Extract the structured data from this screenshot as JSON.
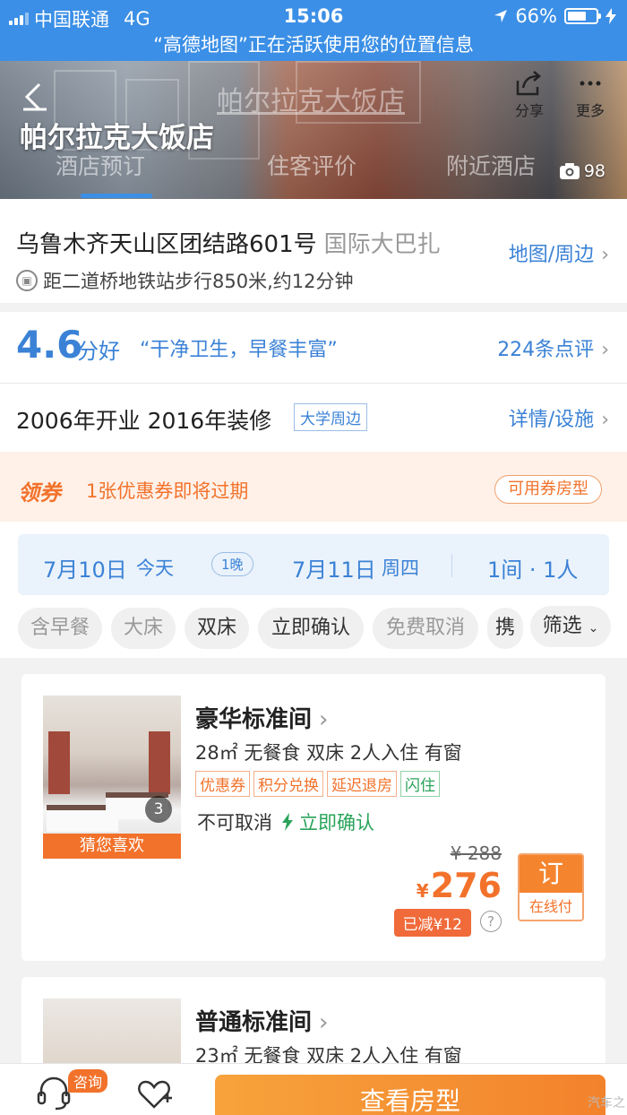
{
  "status": {
    "carrier": "中国联通",
    "network": "4G",
    "time": "15:06",
    "battery": "66%",
    "battery_level": 0.66
  },
  "location_banner": "“高德地图”正在活跃使用您的位置信息",
  "hero": {
    "hotel_name": "帕尔拉克大饭店",
    "ghost_title": "帕尔拉克大饭店",
    "tabs": [
      "酒店预订",
      "住客评价",
      "附近酒店"
    ],
    "share_label": "分享",
    "more_label": "更多",
    "photo_count": "98"
  },
  "address": {
    "street": "乌鲁木齐天山区团结路601号",
    "area": "国际大巴扎",
    "metro": "距二道桥地铁站步行850米,约12分钟",
    "map_link": "地图/周边"
  },
  "rating": {
    "score": "4.6",
    "score_text": "分好",
    "quote": "“干净卫生，早餐丰富”",
    "reviews": "224条点评"
  },
  "info": {
    "opened": "2006年开业 2016年装修",
    "tag": "大学周边",
    "detail_link": "详情/设施"
  },
  "coupon": {
    "label": "领券",
    "text": "1张优惠券即将过期",
    "button": "可用券房型"
  },
  "dates": {
    "checkin": "7月10日",
    "checkin_day": "今天",
    "nights": "1晚",
    "checkout": "7月11日",
    "checkout_day": "周四",
    "rooms": "1间 · 1人"
  },
  "filters": [
    "含早餐",
    "大床",
    "双床",
    "立即确认",
    "免费取消",
    "携"
  ],
  "filter_button": "筛选",
  "rooms": [
    {
      "name": "豪华标准间",
      "info": "28㎡  无餐食 双床 2人入住 有窗",
      "badges": [
        "优惠券",
        "积分兑换",
        "延迟退房",
        "闪住"
      ],
      "cancel": "不可取消",
      "confirm": "立即确认",
      "photo_count": "3",
      "guess": "猜您喜欢",
      "old_price": "¥ 288",
      "currency": "¥",
      "price": "276",
      "reduced": "已减¥12",
      "book": "订",
      "pay": "在线付"
    },
    {
      "name": "普通标准间",
      "info": "23㎡  无餐食 双床 2人入住 有窗"
    }
  ],
  "bottom": {
    "consult": "咨询",
    "cta": "查看房型",
    "watermark": "汽车之"
  }
}
